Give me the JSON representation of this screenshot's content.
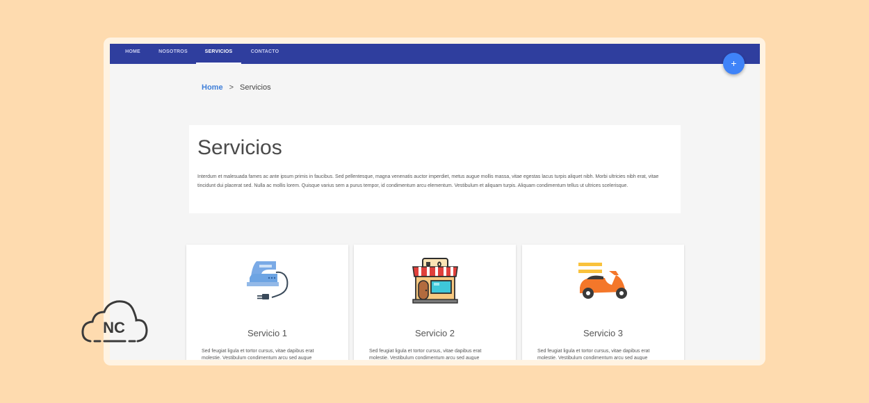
{
  "nav": {
    "items": [
      {
        "label": "HOME"
      },
      {
        "label": "NOSOTROS"
      },
      {
        "label": "SERVICIOS"
      },
      {
        "label": "CONTACTO"
      }
    ],
    "fab_label": "+"
  },
  "breadcrumb": {
    "home": "Home",
    "separator": ">",
    "current": "Servicios"
  },
  "intro": {
    "title": "Servicios",
    "text": "Interdum et malesuada fames ac ante ipsum primis in faucibus. Sed pellentesque, magna venenatis auctor imperdiet, metus augue mollis massa, vitae egestas lacus turpis aliquet nibh. Morbi ultricies nibh erat, vitae tincidunt dui placerat sed. Nulla ac mollis lorem. Quisque varius sem a purus tempor, id condimentum arcu elementum. Vestibulum et aliquam turpis. Aliquam condimentum tellus ut ultrices scelerisque."
  },
  "services": [
    {
      "title": "Servicio 1",
      "icon": "iron-icon",
      "text": "Sed feugiat ligula et tortor cursus, vitae dapibus erat molestie. Vestibulum condimentum arcu sed augue"
    },
    {
      "title": "Servicio 2",
      "icon": "store-icon",
      "text": "Sed feugiat ligula et tortor cursus, vitae dapibus erat molestie. Vestibulum condimentum arcu sed augue"
    },
    {
      "title": "Servicio 3",
      "icon": "delivery-scooter-icon",
      "text": "Sed feugiat ligula et tortor cursus, vitae dapibus erat molestie. Vestibulum condimentum arcu sed augue"
    }
  ],
  "logo": {
    "text": "NC"
  },
  "colors": {
    "navbar": "#2f3e9e",
    "accent": "#3f83f8",
    "background": "#fedbaf"
  }
}
